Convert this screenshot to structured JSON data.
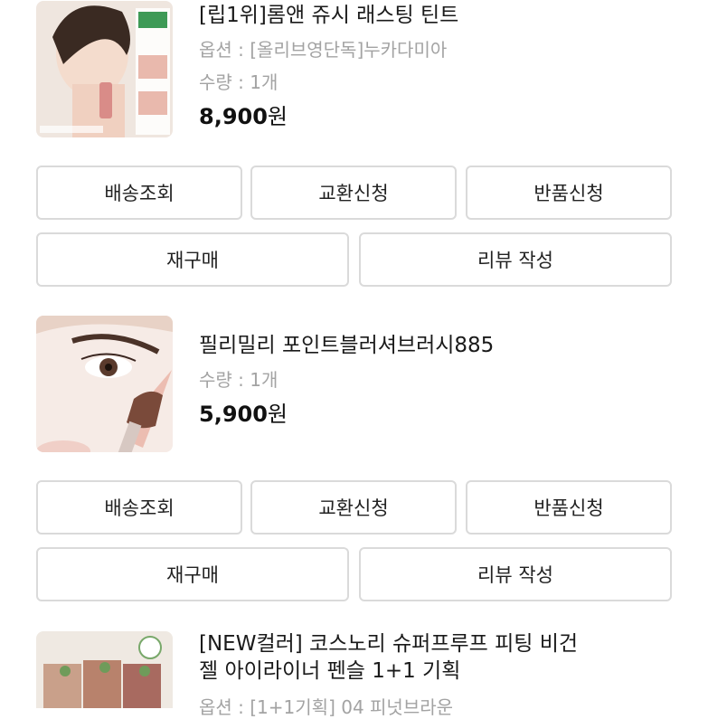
{
  "items": [
    {
      "name": "[립1위]롬앤 쥬시 래스팅 틴트",
      "option": "옵션 : [올리브영단독]누카다미아",
      "quantity": "수량 : 1개",
      "price": "8,900",
      "currency": "원",
      "buttons": {
        "delivery": "배송조회",
        "exchange": "교환신청",
        "return": "반품신청",
        "reorder": "재구매",
        "review": "리뷰 작성"
      }
    },
    {
      "name": "필리밀리 포인트블러셔브러시885",
      "quantity": "수량 : 1개",
      "price": "5,900",
      "currency": "원",
      "buttons": {
        "delivery": "배송조회",
        "exchange": "교환신청",
        "return": "반품신청",
        "reorder": "재구매",
        "review": "리뷰 작성"
      }
    },
    {
      "name_line1": "[NEW컬러] 코스노리 슈퍼프루프 피팅 비건",
      "name_line2": "젤 아이라이너 펜슬 1+1 기획",
      "option": "옵션 : [1+1기획] 04 피넛브라운"
    }
  ]
}
